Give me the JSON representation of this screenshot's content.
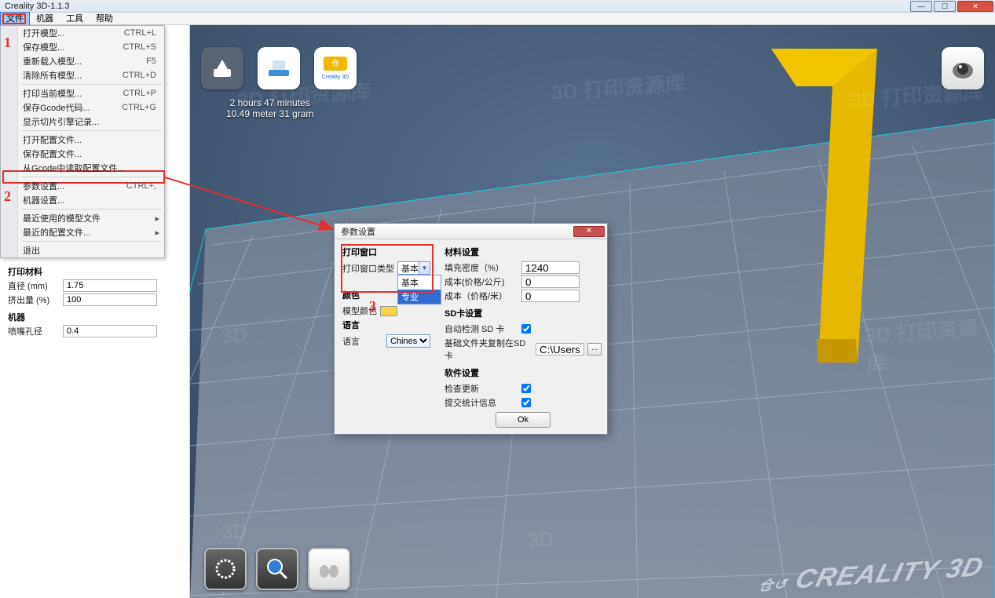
{
  "window": {
    "title": "Creality 3D-1.1.3"
  },
  "menubar": {
    "items": [
      "文件",
      "机器",
      "工具",
      "帮助"
    ],
    "active_index": 0
  },
  "dropdown": {
    "groups": [
      [
        {
          "label": "打开模型...",
          "shortcut": "CTRL+L"
        },
        {
          "label": "保存模型...",
          "shortcut": "CTRL+S"
        },
        {
          "label": "重新载入模型...",
          "shortcut": "F5"
        },
        {
          "label": "清除所有模型...",
          "shortcut": "CTRL+D"
        }
      ],
      [
        {
          "label": "打印当前模型...",
          "shortcut": "CTRL+P"
        },
        {
          "label": "保存Gcode代码...",
          "shortcut": "CTRL+G"
        },
        {
          "label": "显示切片引擎记录..."
        }
      ],
      [
        {
          "label": "打开配置文件..."
        },
        {
          "label": "保存配置文件..."
        },
        {
          "label": "从Gcode中读取配置文件..."
        }
      ],
      [
        {
          "label": "参数设置...",
          "shortcut": "CTRL+,"
        },
        {
          "label": "机器设置..."
        }
      ],
      [
        {
          "label": "最近使用的模型文件",
          "arrow": true
        },
        {
          "label": "最近的配置文件...",
          "arrow": true
        }
      ],
      [
        {
          "label": "退出"
        }
      ]
    ]
  },
  "sidebar": {
    "material_header": "打印材料",
    "machine_header": "机器",
    "rows": [
      {
        "label": "直径 (mm)",
        "value": "1.75"
      },
      {
        "label": "挤出量 (%)",
        "value": "100"
      },
      {
        "label": "喷嘴孔径",
        "value": "0.4"
      }
    ]
  },
  "printinfo": {
    "line1": "2 hours 47 minutes",
    "line2": "10.49 meter 31 gram"
  },
  "dialog": {
    "title": "参数设置",
    "left": {
      "section_print": "打印窗口",
      "print_window_type_label": "打印窗口类型",
      "print_window_type_value": "基本",
      "print_window_options": [
        "基本",
        "专业"
      ],
      "section_color": "颜色",
      "model_color_label": "模型颜色",
      "section_lang": "语言",
      "lang_label": "语言",
      "lang_value": "Chinese"
    },
    "right": {
      "section_material": "材料设置",
      "density_label": "填充密度（%）",
      "density_value": "1240",
      "cost_kg_label": "成本(价格/公斤)",
      "cost_kg_value": "0",
      "cost_m_label": "成本（价格/米）",
      "cost_m_value": "0",
      "section_sd": "SD卡设置",
      "auto_detect_label": "自动检测 SD 卡",
      "auto_detect_checked": true,
      "sd_path_label": "基础文件夹复制在SD卡",
      "sd_path_value": "C:\\Users\\Adminis",
      "section_soft": "软件设置",
      "update_label": "检查更新",
      "update_checked": true,
      "stats_label": "提交统计信息",
      "stats_checked": true
    },
    "ok": "Ok"
  },
  "brand": "CREALITY 3D",
  "annotations": {
    "n1": "1",
    "n2": "2",
    "n3": "3"
  }
}
